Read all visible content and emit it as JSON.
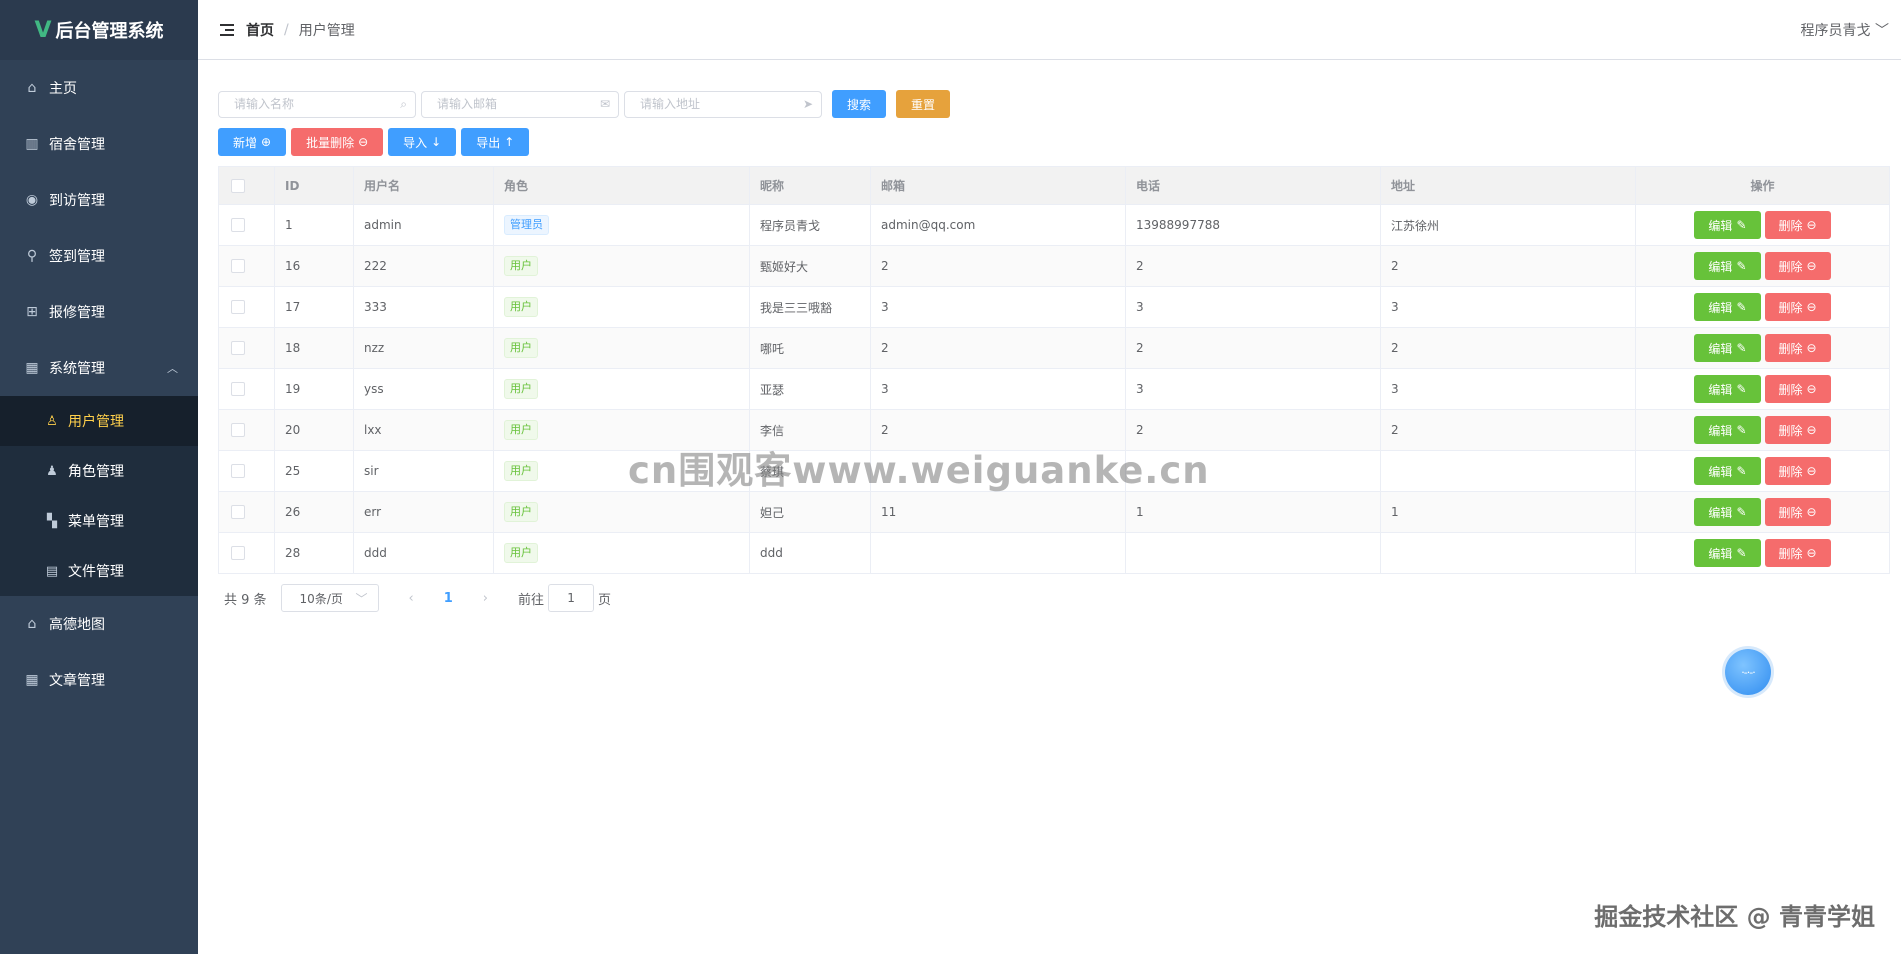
{
  "app": {
    "logo_mark": "V",
    "title": "后台管理系统"
  },
  "sidebar": {
    "items": [
      {
        "label": "主页",
        "icon": "home-icon"
      },
      {
        "label": "宿舍管理",
        "icon": "building-icon"
      },
      {
        "label": "到访管理",
        "icon": "eye-icon"
      },
      {
        "label": "签到管理",
        "icon": "location-icon"
      },
      {
        "label": "报修管理",
        "icon": "repair-icon"
      },
      {
        "label": "系统管理",
        "icon": "grid-icon",
        "expanded": true
      },
      {
        "label": "高德地图",
        "icon": "home-icon"
      },
      {
        "label": "文章管理",
        "icon": "grid-icon"
      }
    ],
    "sub_items": [
      {
        "label": "用户管理",
        "icon": "user-icon",
        "active": true
      },
      {
        "label": "角色管理",
        "icon": "user-filled-icon"
      },
      {
        "label": "菜单管理",
        "icon": "menu-icon"
      },
      {
        "label": "文件管理",
        "icon": "document-icon"
      }
    ]
  },
  "header": {
    "breadcrumb_home": "首页",
    "breadcrumb_sep": "/",
    "breadcrumb_current": "用户管理",
    "user": "程序员青戈"
  },
  "search": {
    "name_placeholder": "请输入名称",
    "email_placeholder": "请输入邮箱",
    "address_placeholder": "请输入地址",
    "search_label": "搜索",
    "reset_label": "重置"
  },
  "actions": {
    "add": "新增",
    "batch_delete": "批量删除",
    "import": "导入",
    "export": "导出"
  },
  "table": {
    "headers": [
      "ID",
      "用户名",
      "角色",
      "昵称",
      "邮箱",
      "电话",
      "地址",
      "操作"
    ],
    "edit_label": "编辑",
    "delete_label": "删除",
    "rows": [
      {
        "id": "1",
        "username": "admin",
        "role": "管理员",
        "role_type": "admin",
        "nickname": "程序员青戈",
        "email": "admin@qq.com",
        "phone": "13988997788",
        "address": "江苏徐州"
      },
      {
        "id": "16",
        "username": "222",
        "role": "用户",
        "role_type": "user",
        "nickname": "甄姬好大",
        "email": "2",
        "phone": "2",
        "address": "2"
      },
      {
        "id": "17",
        "username": "333",
        "role": "用户",
        "role_type": "user",
        "nickname": "我是三三哦豁",
        "email": "3",
        "phone": "3",
        "address": "3"
      },
      {
        "id": "18",
        "username": "nzz",
        "role": "用户",
        "role_type": "user",
        "nickname": "哪吒",
        "email": "2",
        "phone": "2",
        "address": "2"
      },
      {
        "id": "19",
        "username": "yss",
        "role": "用户",
        "role_type": "user",
        "nickname": "亚瑟",
        "email": "3",
        "phone": "3",
        "address": "3"
      },
      {
        "id": "20",
        "username": "lxx",
        "role": "用户",
        "role_type": "user",
        "nickname": "李信",
        "email": "2",
        "phone": "2",
        "address": "2"
      },
      {
        "id": "25",
        "username": "sir",
        "role": "用户",
        "role_type": "user",
        "nickname": "蔡琪",
        "email": "",
        "phone": "",
        "address": ""
      },
      {
        "id": "26",
        "username": "err",
        "role": "用户",
        "role_type": "user",
        "nickname": "妲己",
        "email": "11",
        "phone": "1",
        "address": "1"
      },
      {
        "id": "28",
        "username": "ddd",
        "role": "用户",
        "role_type": "user",
        "nickname": "ddd",
        "email": "",
        "phone": "",
        "address": ""
      }
    ]
  },
  "pagination": {
    "total_label": "共 9 条",
    "page_size": "10条/页",
    "current_page": "1",
    "goto_label": "前往",
    "goto_value": "1",
    "page_unit": "页"
  },
  "watermark": {
    "center": "cn围观客www.weiguanke.cn",
    "corner": "掘金技术社区 @ 青青学姐"
  },
  "colors": {
    "sidebar_bg": "#304156",
    "primary": "#409eff",
    "success": "#67c23a",
    "danger": "#f56c6c",
    "warning": "#e6a23c",
    "active_menu": "#ffd04b"
  }
}
